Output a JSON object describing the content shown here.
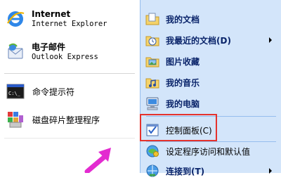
{
  "left": {
    "pinned": [
      {
        "title": "Internet",
        "subtitle": "Internet Explorer",
        "icon": "internet-explorer-icon"
      },
      {
        "title": "电子邮件",
        "subtitle": "Outlook Express",
        "icon": "outlook-express-icon"
      }
    ],
    "recent": [
      {
        "label": "命令提示符",
        "icon": "command-prompt-icon"
      },
      {
        "label": "磁盘碎片整理程序",
        "icon": "disk-defragmenter-icon"
      }
    ]
  },
  "right": {
    "items": [
      {
        "label": "我的文档",
        "icon": "my-documents-icon"
      },
      {
        "label": "我最近的文档(D)",
        "icon": "recent-documents-icon",
        "submenu": true
      },
      {
        "label": "图片收藏",
        "icon": "my-pictures-icon"
      },
      {
        "label": "我的音乐",
        "icon": "my-music-icon"
      },
      {
        "label": "我的电脑",
        "icon": "my-computer-icon"
      },
      {
        "label": "控制面板(C)",
        "icon": "control-panel-icon"
      },
      {
        "label": "设定程序访问和默认值",
        "icon": "program-defaults-icon"
      },
      {
        "label": "连接到(T)",
        "icon": "connect-to-icon",
        "submenu": true
      }
    ]
  },
  "colors": {
    "right_bg": "#d3e5fa",
    "highlight_border": "#e5322d",
    "pointer": "#e32bd0"
  }
}
